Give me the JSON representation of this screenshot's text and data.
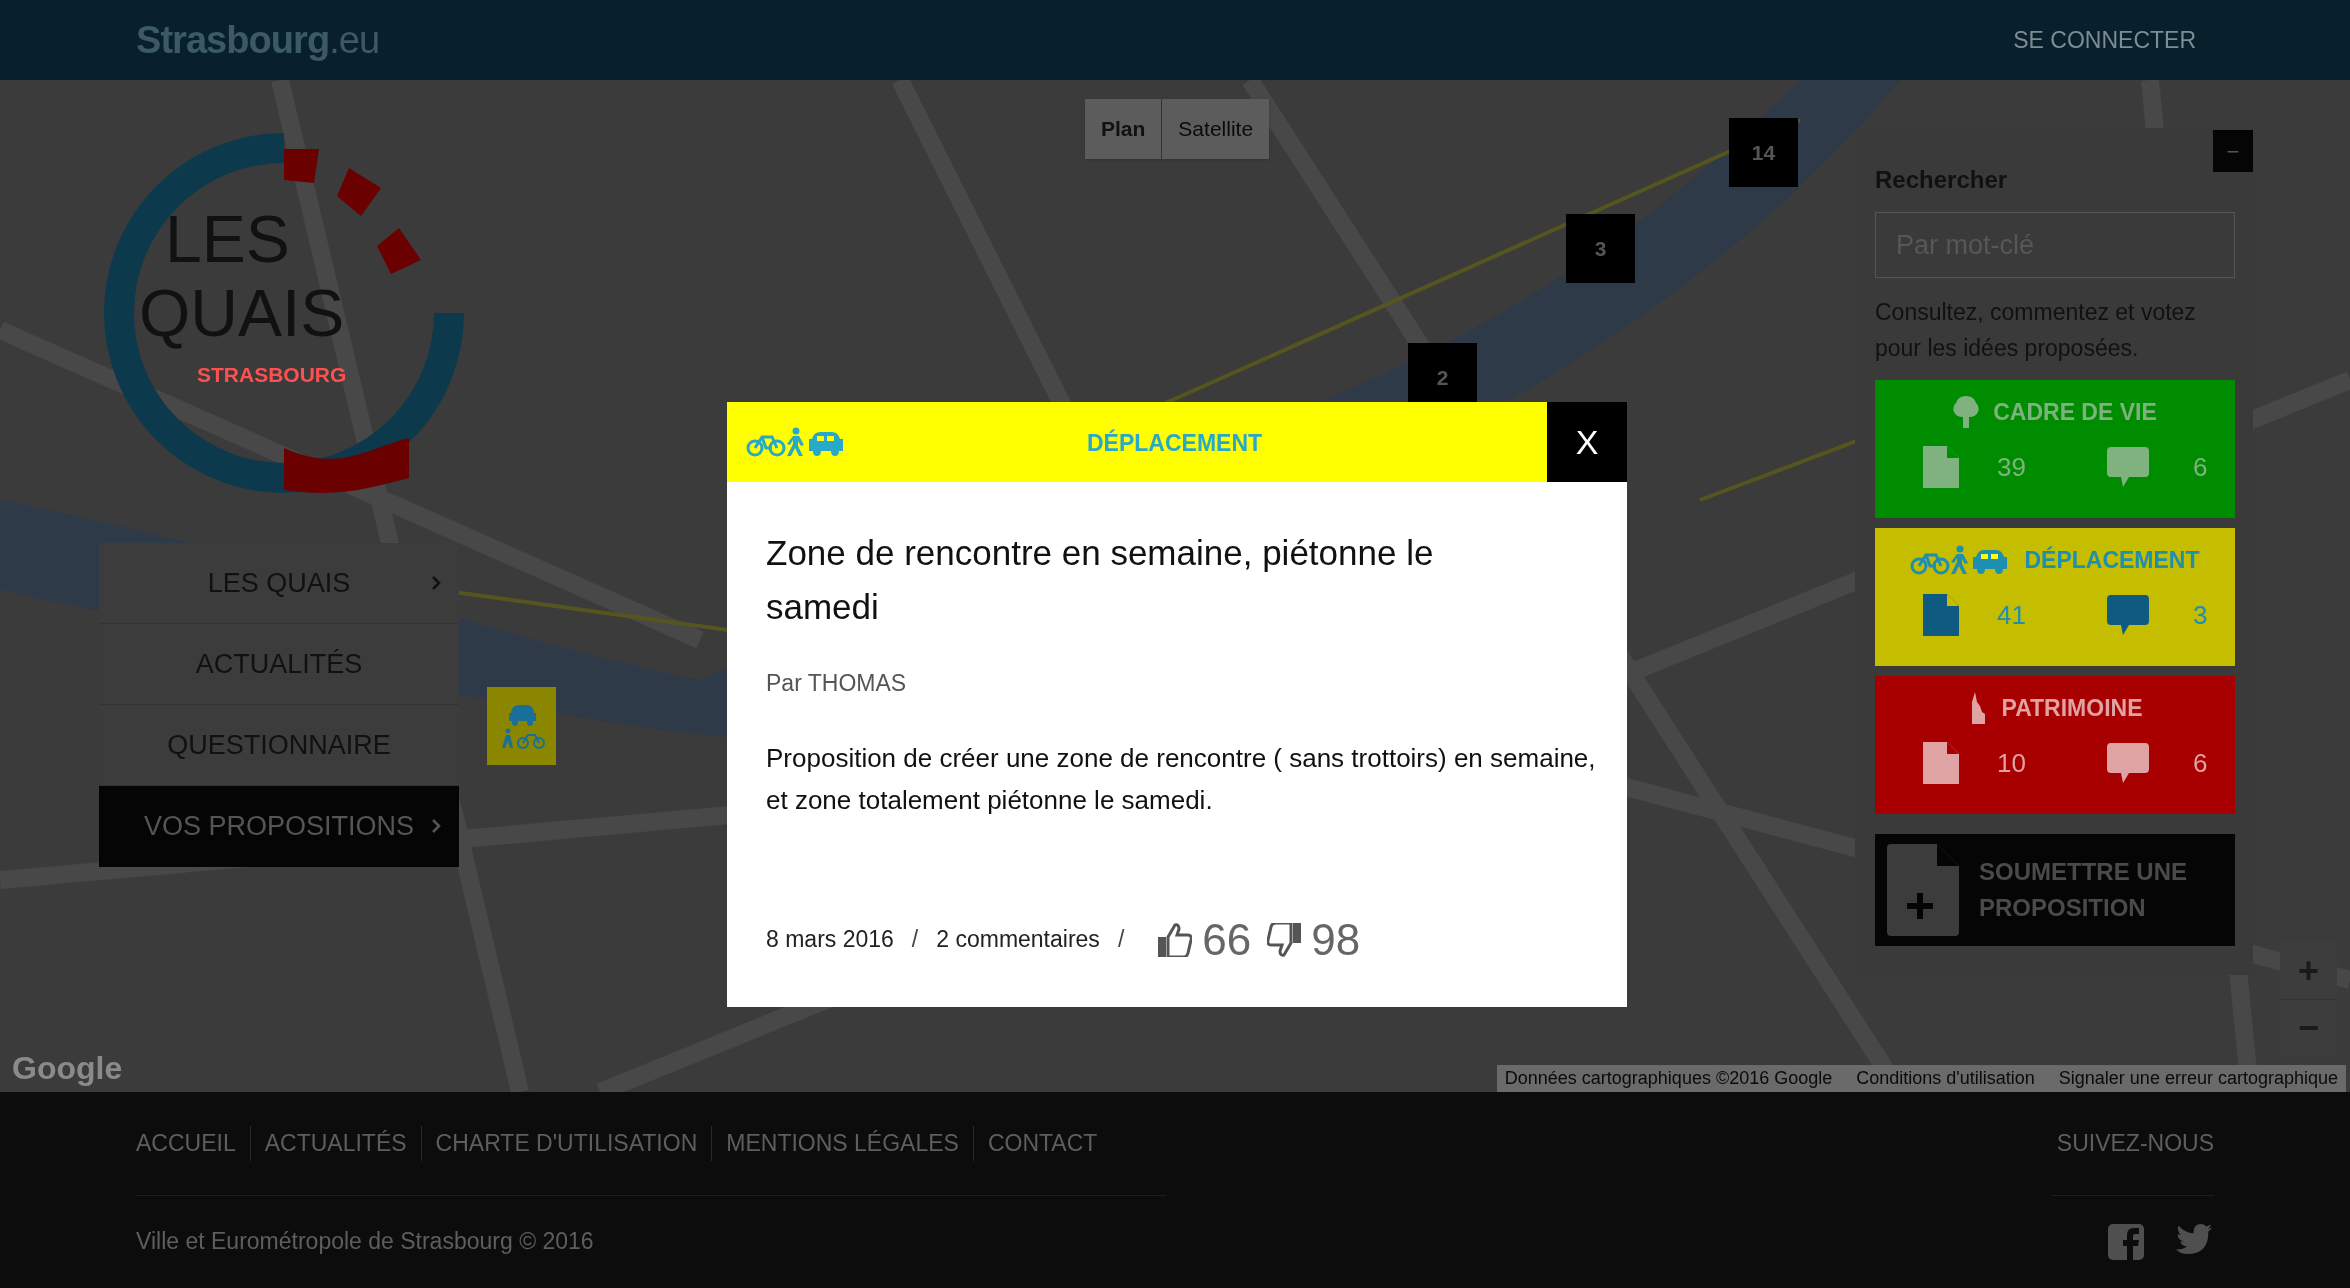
{
  "header": {
    "logo": "**Strasbourg**.eu",
    "login": "SE CONNECTER"
  },
  "map": {
    "view_toggle": [
      {
        "label": "Plan",
        "selected": true
      },
      {
        "label": "Satellite",
        "selected": false
      }
    ],
    "markers": [
      {
        "kind": "count",
        "label": "14"
      },
      {
        "kind": "count",
        "label": "3"
      },
      {
        "kind": "count",
        "label": "2"
      },
      {
        "kind": "category"
      }
    ],
    "zoom_in": "+",
    "zoom_out": "−",
    "provider_logo": "Google",
    "attribution": [
      "Données cartographiques ©2016 Google",
      "Conditions d'utilisation",
      "Signaler une erreur cartographique"
    ]
  },
  "logo": {
    "line_1": "LES",
    "line_2": "QUAIS",
    "subtitle": "STRASBOURG"
  },
  "nav": {
    "items": [
      {
        "label": "LES QUAIS",
        "selected": false,
        "has_submenu": true
      },
      {
        "label": "ACTUALITÉS",
        "selected": false,
        "has_submenu": false
      },
      {
        "label": "QUESTIONNAIRE",
        "selected": false,
        "has_submenu": false
      },
      {
        "label": "VOS PROPOSITIONS",
        "selected": true,
        "has_submenu": true
      }
    ]
  },
  "search_panel": {
    "title": "Rechercher",
    "collapse": "−",
    "placeholder": "Par mot-clé",
    "description": "Consultez, commentez et votez pour les idées proposées.",
    "categories": [
      {
        "kind": "tree",
        "label": "CADRE DE VIE",
        "color": "#008c00",
        "proposals": "39",
        "comments": "6"
      },
      {
        "kind": "transport",
        "label": "DÉPLACEMENT",
        "color": "#c4bd00",
        "proposals": "41",
        "comments": "3"
      },
      {
        "kind": "monument",
        "label": "PATRIMOINE",
        "color": "#a80000",
        "proposals": "10",
        "comments": "6"
      }
    ],
    "submit": "SOUMETTRE UNE PROPOSITION"
  },
  "modal": {
    "category": "DÉPLACEMENT",
    "close": "X",
    "title": "Zone de rencontre en semaine, piétonne le samedi",
    "author": "Par THOMAS",
    "body": "Proposition de créer une zone de rencontre ( sans trottoirs) en semaine, et zone totalement piétonne le samedi.",
    "meta": [
      {
        "kind": "text",
        "text": "8 mars 2016"
      },
      {
        "kind": "separator",
        "text": "/"
      },
      {
        "kind": "text",
        "text": "2 commentaires"
      },
      {
        "kind": "separator",
        "text": "/"
      }
    ],
    "likes": "66",
    "dislikes": "98"
  },
  "footer": {
    "links": [
      "ACCUEIL",
      "ACTUALITÉS",
      "CHARTE D'UTILISATION",
      "MENTIONS LÉGALES",
      "CONTACT"
    ],
    "follow": "SUIVEZ-NOUS",
    "copyright": "Ville et Eurométropole de Strasbourg © 2016"
  }
}
